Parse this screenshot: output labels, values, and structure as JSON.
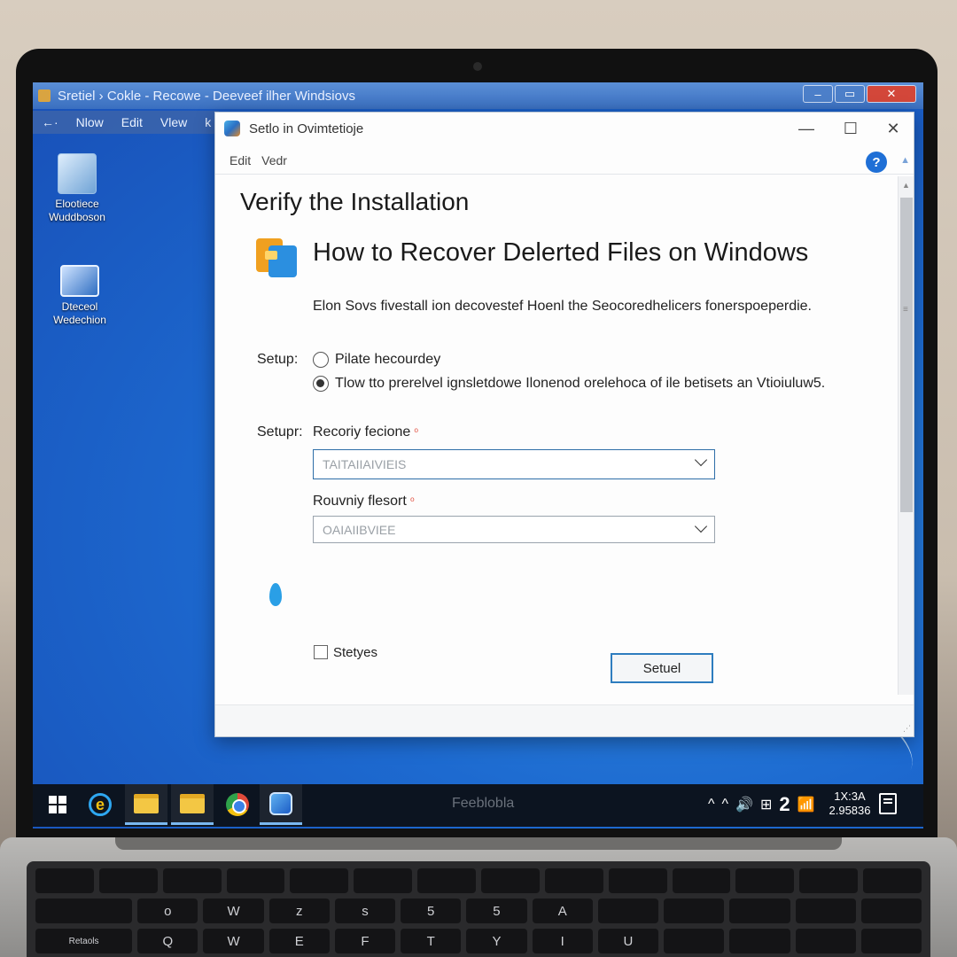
{
  "background_window": {
    "title": "Sretiel › Cokle - Recowe - Deeveef ilher Windsiovs",
    "menu": [
      "←·",
      "Nlow",
      "Edit",
      "Vlew",
      "k"
    ],
    "controls": {
      "minimize": "–",
      "maximize": "▭",
      "close": "✕"
    }
  },
  "desktop_icons": [
    {
      "line1": "Elootiece",
      "line2": "Wuddboson"
    },
    {
      "line1": "Dteceol",
      "line2": "Wedechion"
    }
  ],
  "dialog": {
    "title": "Setlo in Ovimtetioje",
    "controls": {
      "minimize": "—",
      "maximize": "☐",
      "close": "✕"
    },
    "menu": [
      "Edit",
      "Vedr"
    ],
    "help": "?",
    "heading": "Verify the Installation",
    "app_title": "How to Recover Delerted Files on Windows",
    "description": "Elon Sovs fivestall ion decovestef Hoenl the Seocoredhelicers fonerspoeperdie.",
    "setup_label_1": "Setup:",
    "radio_options": [
      {
        "label": "Pilate hecourdey",
        "selected": false
      },
      {
        "label": "Tlow tto prerelvel ignsletdowe Ilonenod orelehoca of ile betisets an Vtioiuluw5.",
        "selected": true
      }
    ],
    "setup_label_2": "Setupr:",
    "field1": {
      "label": "Recoriy fecione",
      "value": "TAITAIIAIVIEIS"
    },
    "field2": {
      "label": "Rouvniy flesort",
      "value": "OAIAIIBVIEE"
    },
    "required_mark": "⁰",
    "checkbox": {
      "label": "Stetyes",
      "checked": false
    },
    "button": "Setuel"
  },
  "taskbar": {
    "brand": "Feeblobla",
    "tray": [
      "^",
      "^",
      "🔊",
      "⊞",
      "2",
      "📶"
    ],
    "clock": {
      "time": "1X:3A",
      "date": "2.95836"
    }
  },
  "keyboard": {
    "row1": [
      "",
      "",
      "",
      "",
      "",
      "",
      "",
      "",
      "",
      "",
      "",
      "",
      "",
      ""
    ],
    "row2": [
      "",
      "o",
      "W",
      "z",
      "s",
      "5",
      "5",
      "A",
      "",
      "",
      "",
      "",
      "",
      ""
    ],
    "row3": [
      "Retaols",
      "Q",
      "W",
      "E",
      "F",
      "T",
      "Y",
      "I",
      "U",
      "",
      "",
      "",
      "",
      ""
    ]
  },
  "colors": {
    "desktop": "#1d6ad0",
    "accent_border": "#2e6ea8",
    "help_button": "#1f6fd6",
    "required": "#e04a3a"
  }
}
